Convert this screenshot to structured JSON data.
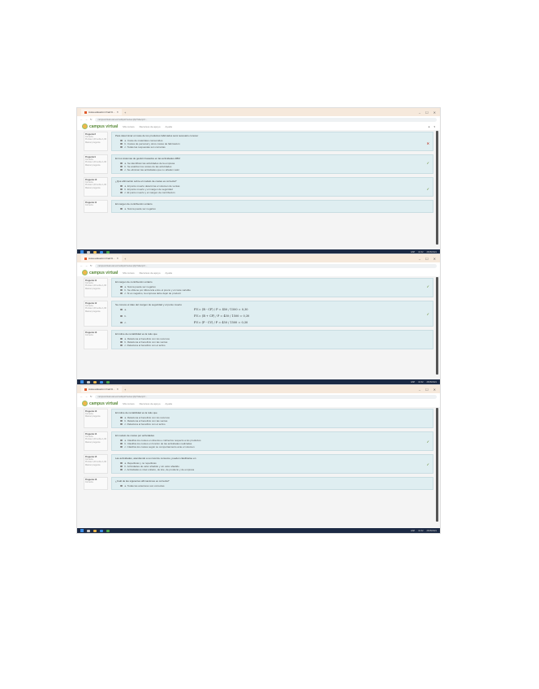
{
  "browser": {
    "tab_title": "Autoevaluación final bl...",
    "url": "campusvirtual.usal.es/mod/quiz/review.php?attempt=...",
    "window_controls": [
      "–",
      "☐",
      "✕"
    ]
  },
  "site": {
    "logo_text": "campus virtual",
    "nav_links": [
      "Mis cursos",
      "Recursos de apoyo",
      "Ayuda"
    ]
  },
  "question_info": {
    "label": "Pregunta",
    "status": "Correcta",
    "score": "Puntúa 1,00 sobre 1,00",
    "flag": "Marcar pregunta"
  },
  "screens": [
    {
      "questions": [
        {
          "number": "8",
          "text": "Para determinar el coste de los productos fabricados será necesario conocer",
          "options": [
            "a. Coste de materiales consumidos",
            "b. Costes de personal y otros costes de fabricación",
            "c. Todas las respuestas son correctas"
          ],
          "mark": "✕"
        },
        {
          "number": "9",
          "text": "En los sistemas de gestión basados en las actividades ABM",
          "options": [
            "a. Se identifican las actividades de la empresa",
            "b. Se analizan los costes de las actividades",
            "c. Se eliminan las actividades que no añaden valor"
          ],
          "mark": "✓"
        },
        {
          "number": "10",
          "text": "¿Qué afirmación sobre el modelo de costes es correcta?",
          "options": [
            "a. El punto muerto determina el volumen de ventas",
            "b. El punto muerto y el margen de seguridad",
            "c. El punto muerto y el margen de contribución"
          ],
          "mark": "✓"
        },
        {
          "number": "11",
          "text": "El margen de contribución unitario",
          "options": [
            "a. Nunca puede ser negativo"
          ],
          "mark": ""
        }
      ]
    },
    {
      "questions": [
        {
          "number": "11",
          "text": "El margen de contribución unitario",
          "options": [
            "a. Nunca puede ser negativo",
            "b. Se obtiene por diferencia entre el precio y el coste variable",
            "c. Si es negativo, la empresa debe dejar de producir"
          ],
          "mark": "✓"
        },
        {
          "number": "12",
          "text": "Se conoce el dato del margen de seguridad y el punto muerto",
          "options": [
            "a.",
            "b.",
            "c."
          ],
          "formulas": [
            "P.V.= (B - CF) / P = 450 / 1500 = 0,30",
            "P.V.= (B + CF) / P = 450 / 1500 = 0,30",
            "P.V.= (P - CV) / P = 450 / 1500 = 0,30"
          ],
          "mark": "✓"
        },
        {
          "number": "13",
          "text": "El índice de rentabilidad es la ratio que",
          "options": [
            "a. Relaciona el beneficio con los recursos",
            "b. Relaciona el beneficio con las ventas",
            "c. Relaciona el beneficio con el activo"
          ],
          "mark": ""
        }
      ]
    },
    {
      "questions": [
        {
          "number": "13",
          "text": "El índice de rentabilidad es la ratio que",
          "options": [
            "a. Relaciona el beneficio con los recursos",
            "b. Relaciona el beneficio con las ventas",
            "c. Relaciona el beneficio con el activo"
          ],
          "mark": ""
        },
        {
          "number": "14",
          "text": "El modelo de costes por actividades",
          "options": [
            "a. Clasifica los costes en directos e indirectos respecto a los productos",
            "b. Clasifica los costes en función de las actividades realizadas",
            "c. Clasifica los costes según su comportamiento ante el volumen"
          ],
          "mark": "✓"
        },
        {
          "number": "15",
          "text": "Las actividades, atendiendo a su nivel de consumo, pueden clasificarse en",
          "options": [
            "a. Repetitivas y no repetitivas",
            "b. Actividades de valor añadido y sin valor añadido",
            "c. Actividades a nivel unitario, de lote, de producto y de empresa"
          ],
          "mark": "✓"
        },
        {
          "number": "16",
          "text": "¿Cuál de las siguientes afirmaciones es correcta?",
          "options": [
            "a. Todas las anteriores son correctas"
          ],
          "mark": ""
        }
      ]
    }
  ],
  "taskbar": {
    "time": "10:32",
    "date": "26/05/2021",
    "lang": "ESP"
  },
  "colors": {
    "tabbar": "#f6e9dc",
    "question_bg": "#dfeef1",
    "correct": "#6c8f3a",
    "incorrect": "#c0392b",
    "taskbar": "#1c2a44"
  }
}
